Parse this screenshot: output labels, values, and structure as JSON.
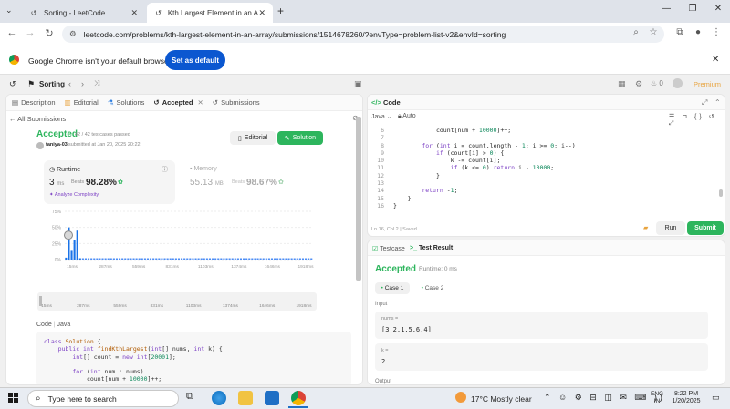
{
  "browser": {
    "tabs": [
      {
        "title": "Sorting - LeetCode",
        "active": false
      },
      {
        "title": "Kth Largest Element in an Array",
        "active": true
      }
    ],
    "url": "leetcode.com/problems/kth-largest-element-in-an-array/submissions/1514678260/?envType=problem-list-v2&envId=sorting",
    "infobar_text": "Google Chrome isn't your default browser",
    "set_default_label": "Set as default"
  },
  "lc_top": {
    "list_name": "Sorting",
    "premium_label": "Premium",
    "fire_count": "0"
  },
  "left_tabs": [
    "Description",
    "Editorial",
    "Solutions",
    "Accepted",
    "Submissions"
  ],
  "submission": {
    "back_label": "All Submissions",
    "status": "Accepted",
    "testcases": "42 / 42 testcases passed",
    "user": "taniya-03",
    "submitted_at": "submitted at Jan 20, 2025 20:22",
    "editorial_btn": "Editorial",
    "solution_btn": "Solution",
    "runtime_label": "Runtime",
    "runtime_value": "3",
    "runtime_unit": "ms",
    "beats_label": "Beats",
    "runtime_beats": "98.28%",
    "analyze_label": "Analyze Complexity",
    "memory_label": "Memory",
    "memory_value": "55.13",
    "memory_unit": "MB",
    "memory_beats": "98.67%",
    "code_label": "Code",
    "lang_label": "Java"
  },
  "chart_data": {
    "type": "bar",
    "y_ticks": [
      "75%",
      "50%",
      "25%",
      "0%"
    ],
    "x_ticks": [
      "15ms",
      "287ms",
      "559ms",
      "831ms",
      "1103ms",
      "1374ms",
      "1646ms",
      "1918ms"
    ],
    "x_ticks_nav": [
      "15ms",
      "287ms",
      "559ms",
      "831ms",
      "1103ms",
      "1374ms",
      "1646ms",
      "1918ms"
    ],
    "ylim": [
      0,
      75
    ],
    "values": [
      3,
      50,
      15,
      30,
      45,
      2,
      1,
      1,
      1,
      1,
      1,
      1,
      1,
      1,
      1,
      1,
      1,
      1,
      1,
      1,
      1,
      1,
      1,
      1,
      1,
      1,
      1,
      1,
      1,
      1,
      1,
      1,
      1,
      1,
      1,
      1,
      1,
      1,
      1,
      1,
      1,
      1,
      1,
      1,
      1,
      1,
      1,
      1,
      1,
      1,
      1,
      1,
      1,
      1,
      1,
      1,
      1,
      1,
      1,
      1,
      1,
      1,
      1,
      1,
      1,
      1,
      1,
      1,
      1,
      1,
      1,
      1,
      1,
      1,
      1,
      1,
      1,
      1,
      1,
      1,
      1,
      1,
      1,
      1,
      1,
      1,
      1,
      1
    ],
    "highlight_index": 0
  },
  "left_code": [
    "class Solution {",
    "    public int findKthLargest(int[] nums, int k) {",
    "        int[] count = new int[20001];",
    "",
    "        for (int num : nums)",
    "            count[num + 10000]++;"
  ],
  "editor": {
    "title": "Code",
    "lang": "Java",
    "mode": "Auto",
    "status": "Ln 16, Col 2",
    "saved": "Saved",
    "run_label": "Run",
    "submit_label": "Submit",
    "lines": [
      {
        "n": "6",
        "t": "            count[num + 10000]++;"
      },
      {
        "n": "7",
        "t": ""
      },
      {
        "n": "8",
        "t": "        for (int i = count.length - 1; i >= 0; i--)"
      },
      {
        "n": "9",
        "t": "            if (count[i] > 0) {"
      },
      {
        "n": "10",
        "t": "                k -= count[i];"
      },
      {
        "n": "11",
        "t": "                if (k <= 0) return i - 10000;"
      },
      {
        "n": "12",
        "t": "            }"
      },
      {
        "n": "13",
        "t": ""
      },
      {
        "n": "14",
        "t": "        return -1;"
      },
      {
        "n": "15",
        "t": "    }"
      },
      {
        "n": "16",
        "t": "}"
      }
    ]
  },
  "test": {
    "tab1": "Testcase",
    "tab2": "Test Result",
    "status": "Accepted",
    "runtime": "Runtime: 0 ms",
    "case1": "Case 1",
    "case2": "Case 2",
    "input_label": "Input",
    "nums_label": "nums =",
    "nums_value": "[3,2,1,5,6,4]",
    "k_label": "k =",
    "k_value": "2",
    "output_label": "Output"
  },
  "taskbar": {
    "search_placeholder": "Type here to search",
    "weather": "17°C  Mostly clear",
    "lang_top": "ENG",
    "lang_bottom": "IN",
    "time": "8:22 PM",
    "date": "1/20/2025"
  }
}
